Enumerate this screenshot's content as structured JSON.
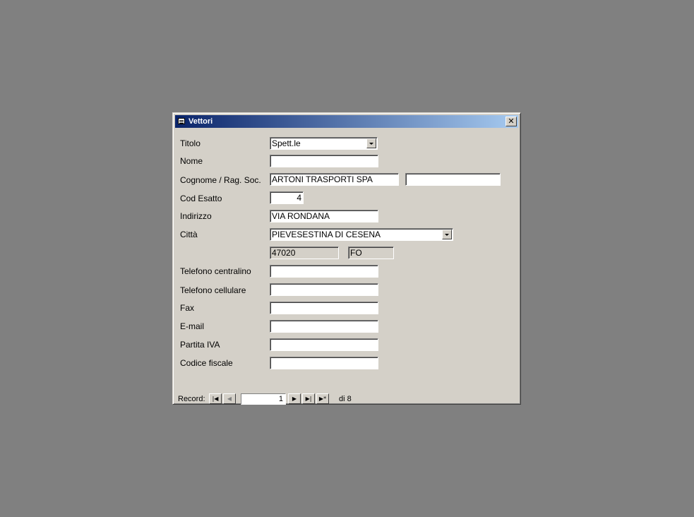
{
  "window": {
    "title": "Vettori",
    "close_symbol": "✕"
  },
  "form": {
    "titolo_label": "Titolo",
    "titolo_value": "Spett.le",
    "nome_label": "Nome",
    "nome_value": "",
    "cognome_label": "Cognome / Rag. Soc.",
    "cognome_value": "ARTONI TRASPORTI SPA",
    "cognome2_value": "",
    "cod_esatto_label": "Cod Esatto",
    "cod_esatto_value": "4",
    "indirizzo_label": "Indirizzo",
    "indirizzo_value": "VIA RONDANA",
    "citta_label": "Città",
    "citta_value": "PIEVESESTINA DI CESENA",
    "cap_value": "47020",
    "provincia_value": "FO",
    "tel_centralino_label": "Telefono centralino",
    "tel_centralino_value": "",
    "tel_cellulare_label": "Telefono cellulare",
    "tel_cellulare_value": "",
    "fax_label": "Fax",
    "fax_value": "",
    "email_label": "E-mail",
    "email_value": "",
    "partita_iva_label": "Partita IVA",
    "partita_iva_value": "",
    "codice_fiscale_label": "Codice fiscale",
    "codice_fiscale_value": ""
  },
  "navigation": {
    "record_label": "Record:",
    "first_icon": "first-record-icon",
    "prev_icon": "previous-record-icon",
    "next_icon": "next-record-icon",
    "last_icon": "last-record-icon",
    "new_icon": "new-record-icon",
    "first_symbol": "|◀",
    "prev_symbol": "◀",
    "next_symbol": "▶",
    "last_symbol": "▶|",
    "new_symbol": "▶*",
    "current_record": "1",
    "total_text": "di 8"
  }
}
